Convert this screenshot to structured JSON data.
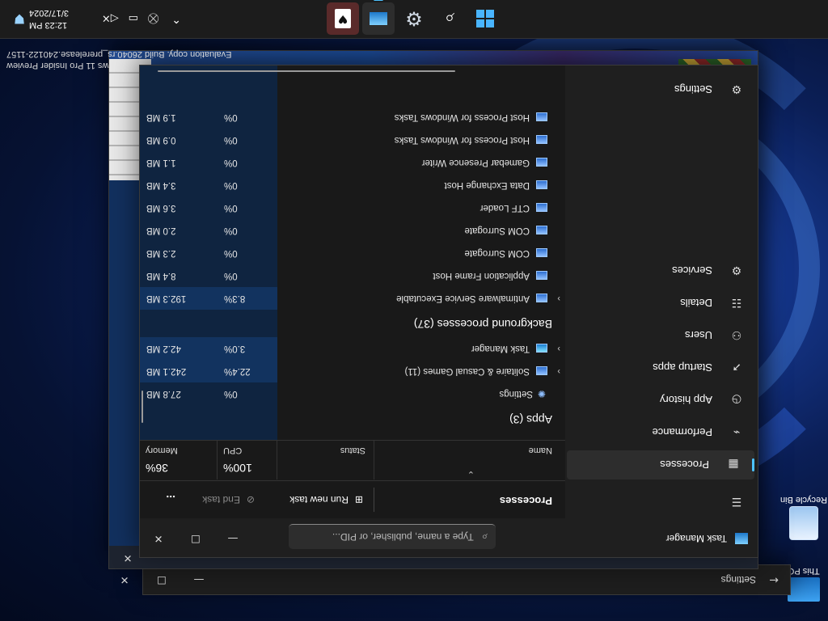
{
  "watermark": {
    "line1": "Evaluation copy. Build 26040.rs_prerelease.240122-1157",
    "line2": "ws 11 Pro Insider Preview"
  },
  "desktop_icons": [
    {
      "label": "Recycle Bin"
    },
    {
      "label": "This PC"
    }
  ],
  "settings_window": {
    "title": "Settings"
  },
  "taskbar": {
    "apps": [
      {
        "icon": "start-icon"
      },
      {
        "icon": "search-icon"
      },
      {
        "icon": "settings-icon"
      },
      {
        "icon": "task-manager-icon"
      },
      {
        "icon": "solitaire-icon"
      }
    ],
    "clock_time": "12:23 PM",
    "clock_date": "3/17/2024"
  },
  "task_manager": {
    "title": "Task Manager",
    "search_placeholder": "Type a name, publisher, or PID...",
    "nav": [
      {
        "label": "Processes",
        "icon": "processes-icon",
        "selected": true
      },
      {
        "label": "Performance",
        "icon": "performance-icon"
      },
      {
        "label": "App history",
        "icon": "app-history-icon"
      },
      {
        "label": "Startup apps",
        "icon": "startup-icon"
      },
      {
        "label": "Users",
        "icon": "users-icon"
      },
      {
        "label": "Details",
        "icon": "details-icon"
      },
      {
        "label": "Services",
        "icon": "services-icon"
      }
    ],
    "nav_settings": "Settings",
    "page_title": "Processes",
    "run_new_task": "Run new task",
    "end_task": "End task",
    "more": "...",
    "columns": {
      "name": "Name",
      "status": "Status",
      "cpu_pct": "100%",
      "cpu": "CPU",
      "mem_pct": "36%",
      "mem": "Memory"
    },
    "apps_header": "Apps (3)",
    "apps": [
      {
        "name": "Settings",
        "cpu": "0%",
        "mem": "27.8 MB"
      },
      {
        "name": "Solitaire & Casual Games (11)",
        "cpu": "22.4%",
        "mem": "242.1 MB"
      },
      {
        "name": "Task Manager",
        "cpu": "3.0%",
        "mem": "42.2 MB"
      }
    ],
    "bg_header": "Background processes (37)",
    "background": [
      {
        "name": "Antimalware Service Executable",
        "cpu": "8.3%",
        "mem": "192.3 MB"
      },
      {
        "name": "Application Frame Host",
        "cpu": "0%",
        "mem": "8.4 MB"
      },
      {
        "name": "COM Surrogate",
        "cpu": "0%",
        "mem": "2.3 MB"
      },
      {
        "name": "COM Surrogate",
        "cpu": "0%",
        "mem": "2.0 MB"
      },
      {
        "name": "CTF Loader",
        "cpu": "0%",
        "mem": "3.6 MB"
      },
      {
        "name": "Data Exchange Host",
        "cpu": "0%",
        "mem": "3.4 MB"
      },
      {
        "name": "Gamebar Presence Writer",
        "cpu": "0%",
        "mem": "1.1 MB"
      },
      {
        "name": "Host Process for Windows Tasks",
        "cpu": "0%",
        "mem": "0.9 MB"
      },
      {
        "name": "Host Process for Windows Tasks",
        "cpu": "0%",
        "mem": "1.9 MB"
      }
    ]
  }
}
